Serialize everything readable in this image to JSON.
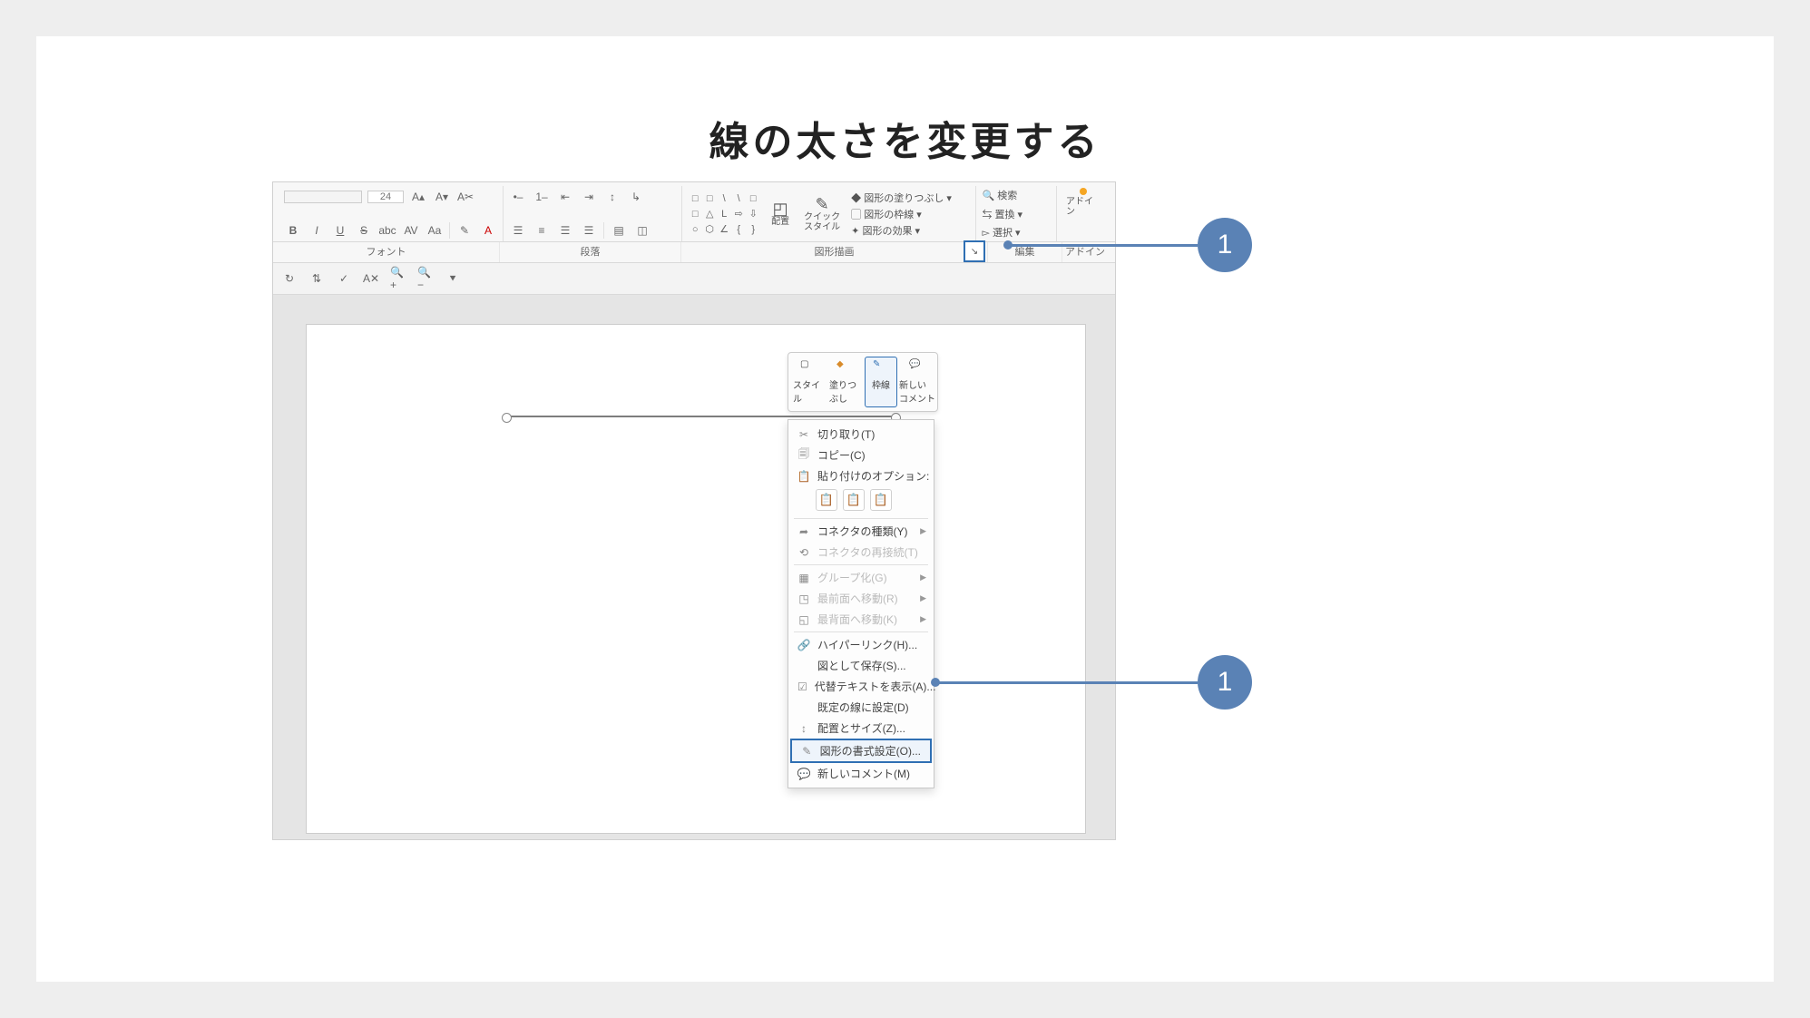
{
  "title": "線の太さを変更する",
  "ribbon": {
    "group_font_label": "フォント",
    "group_para_label": "段落",
    "group_draw_label": "図形描画",
    "group_edit_label": "編集",
    "group_addin_label": "アドイン",
    "font_size_placeholder": "24",
    "shape_fill": "図形の塗りつぶし",
    "shape_outline": "図形の枠線",
    "shape_effects": "図形の効果",
    "arrange": "配置",
    "quick_style": "クイック\nスタイル",
    "find": "検索",
    "replace": "置換",
    "select": "選択",
    "addin": "アドイン"
  },
  "minitoolbar": {
    "style": "スタイル",
    "fill": "塗りつぶし",
    "outline": "枠線",
    "comment": "新しい\nコメント"
  },
  "context_menu": {
    "cut": "切り取り(T)",
    "copy": "コピー(C)",
    "paste_options": "貼り付けのオプション:",
    "connector_type": "コネクタの種類(Y)",
    "connector_reconnect": "コネクタの再接続(T)",
    "group": "グループ化(G)",
    "bring_front": "最前面へ移動(R)",
    "send_back": "最背面へ移動(K)",
    "hyperlink": "ハイパーリンク(H)...",
    "save_as_picture": "図として保存(S)...",
    "alt_text": "代替テキストを表示(A)...",
    "default_line": "既定の線に設定(D)",
    "size_position": "配置とサイズ(Z)...",
    "format_shape": "図形の書式設定(O)...",
    "new_comment": "新しいコメント(M)"
  },
  "callouts": {
    "badge1": "1"
  }
}
